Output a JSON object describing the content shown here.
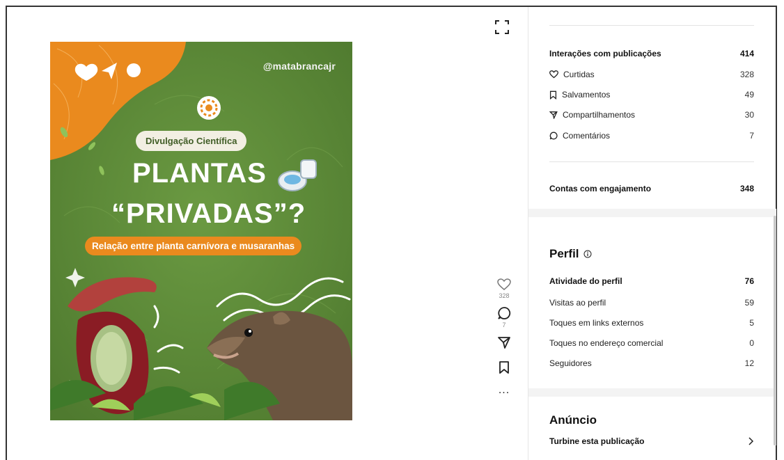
{
  "post": {
    "handle": "@matabrancajr",
    "tag": "Divulgação Científica",
    "title_line1": "PLANTAS",
    "title_line2": "“PRIVADAS”?",
    "subtitle": "Relação entre planta carnívora e musaranhas"
  },
  "actions": {
    "likes": "328",
    "comments": "7",
    "more": "..."
  },
  "interactions": {
    "header": "Interações com publicações",
    "total": "414",
    "items": [
      {
        "icon": "heart-icon",
        "label": "Curtidas",
        "value": "328"
      },
      {
        "icon": "bookmark-icon",
        "label": "Salvamentos",
        "value": "49"
      },
      {
        "icon": "share-icon",
        "label": "Compartilhamentos",
        "value": "30"
      },
      {
        "icon": "comment-icon",
        "label": "Comentários",
        "value": "7"
      }
    ]
  },
  "engagement": {
    "label": "Contas com engajamento",
    "value": "348"
  },
  "profile": {
    "title": "Perfil",
    "info_icon": "info-icon",
    "activity_label": "Atividade do perfil",
    "activity_value": "76",
    "items": [
      {
        "label": "Visitas ao perfil",
        "value": "59"
      },
      {
        "label": "Toques em links externos",
        "value": "5"
      },
      {
        "label": "Toques no endereço comercial",
        "value": "0"
      },
      {
        "label": "Seguidores",
        "value": "12"
      }
    ]
  },
  "ad": {
    "title": "Anúncio",
    "boost_label": "Turbine esta publicação"
  },
  "colors": {
    "post_green": "#5e8a3a",
    "post_orange": "#ea8a1e"
  }
}
